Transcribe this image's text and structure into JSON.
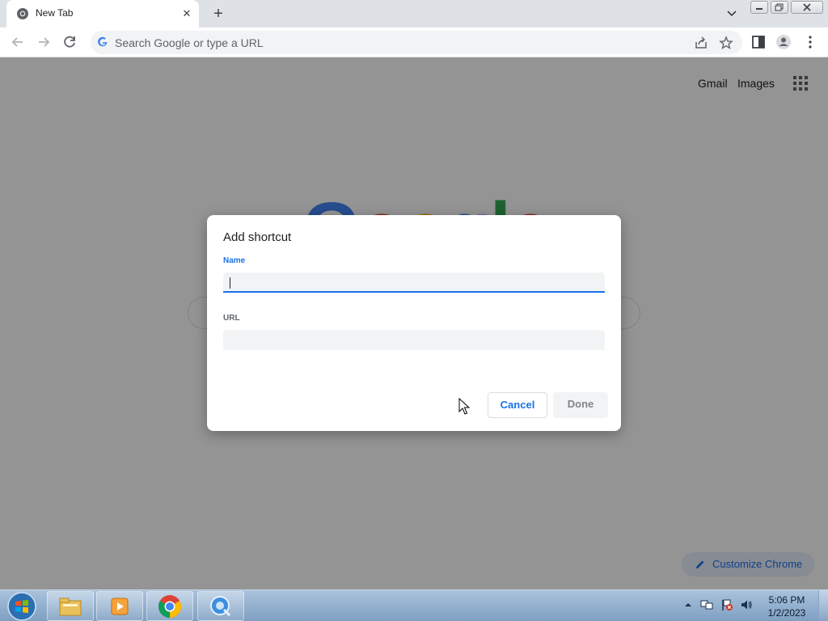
{
  "browser": {
    "tab": {
      "title": "New Tab",
      "favicon": "chrome-icon",
      "close": "close-icon"
    },
    "new_tab": "plus-icon",
    "omnibox": {
      "placeholder": "Search Google or type a URL"
    }
  },
  "ntp": {
    "links": {
      "gmail": "Gmail",
      "images": "Images"
    },
    "logo_colors": [
      "#4285f4",
      "#ea4335",
      "#fbbc05",
      "#4285f4",
      "#34a853",
      "#ea4335"
    ],
    "customize_label": "Customize Chrome"
  },
  "dialog": {
    "title": "Add shortcut",
    "name_label": "Name",
    "name_value": "",
    "url_label": "URL",
    "url_value": "",
    "cancel_label": "Cancel",
    "done_label": "Done"
  },
  "taskbar": {
    "items": [
      "windows-explorer-icon",
      "media-player-icon",
      "chrome-icon",
      "quicktime-icon"
    ],
    "clock": {
      "time": "5:06 PM",
      "date": "1/2/2023"
    }
  },
  "colors": {
    "accent": "#1a73e8",
    "overlay": "#000000"
  }
}
